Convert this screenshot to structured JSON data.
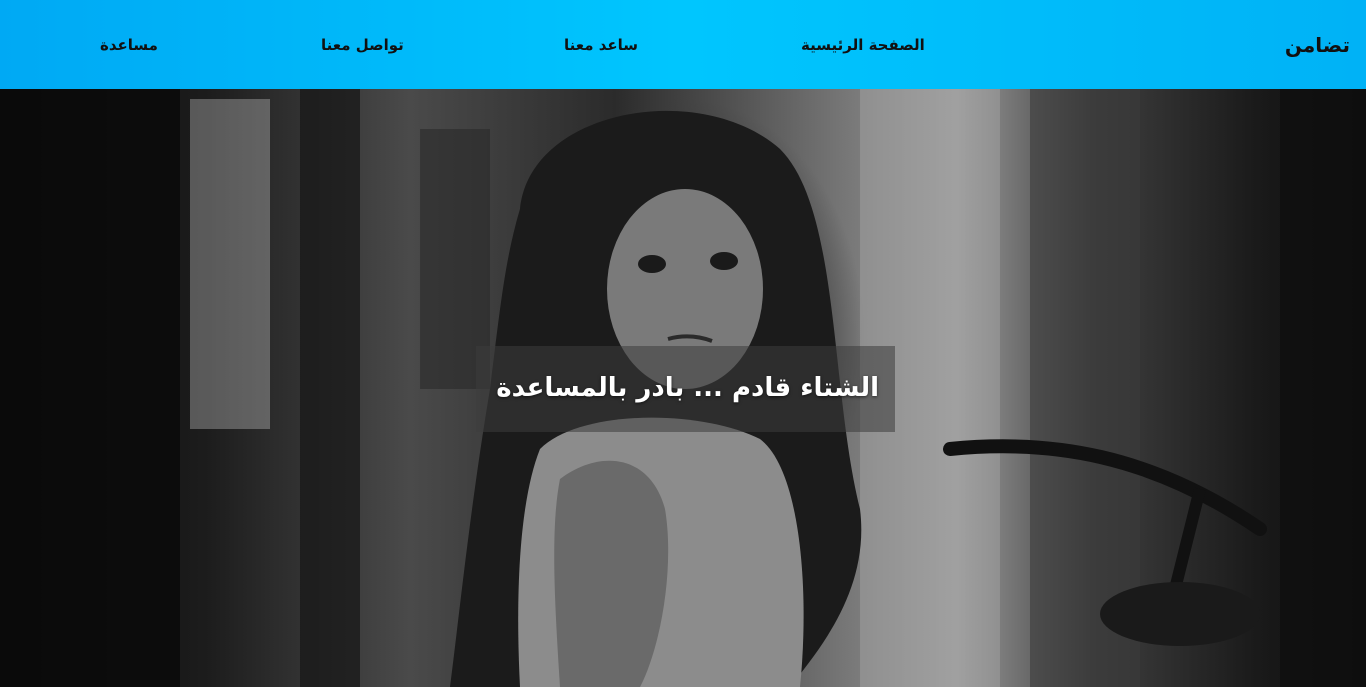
{
  "navbar": {
    "brand": "تضامن",
    "links": {
      "home": "الصفحة الرئيسية",
      "help_us": "ساعد معنا",
      "contact": "تواصل معنا",
      "support": "مساعدة"
    },
    "background_color": "#00c6fe"
  },
  "hero": {
    "headline": "الشتاء قادم ... بادر بالمساعدة",
    "image_description_icon": "photo-child-grayscale"
  }
}
